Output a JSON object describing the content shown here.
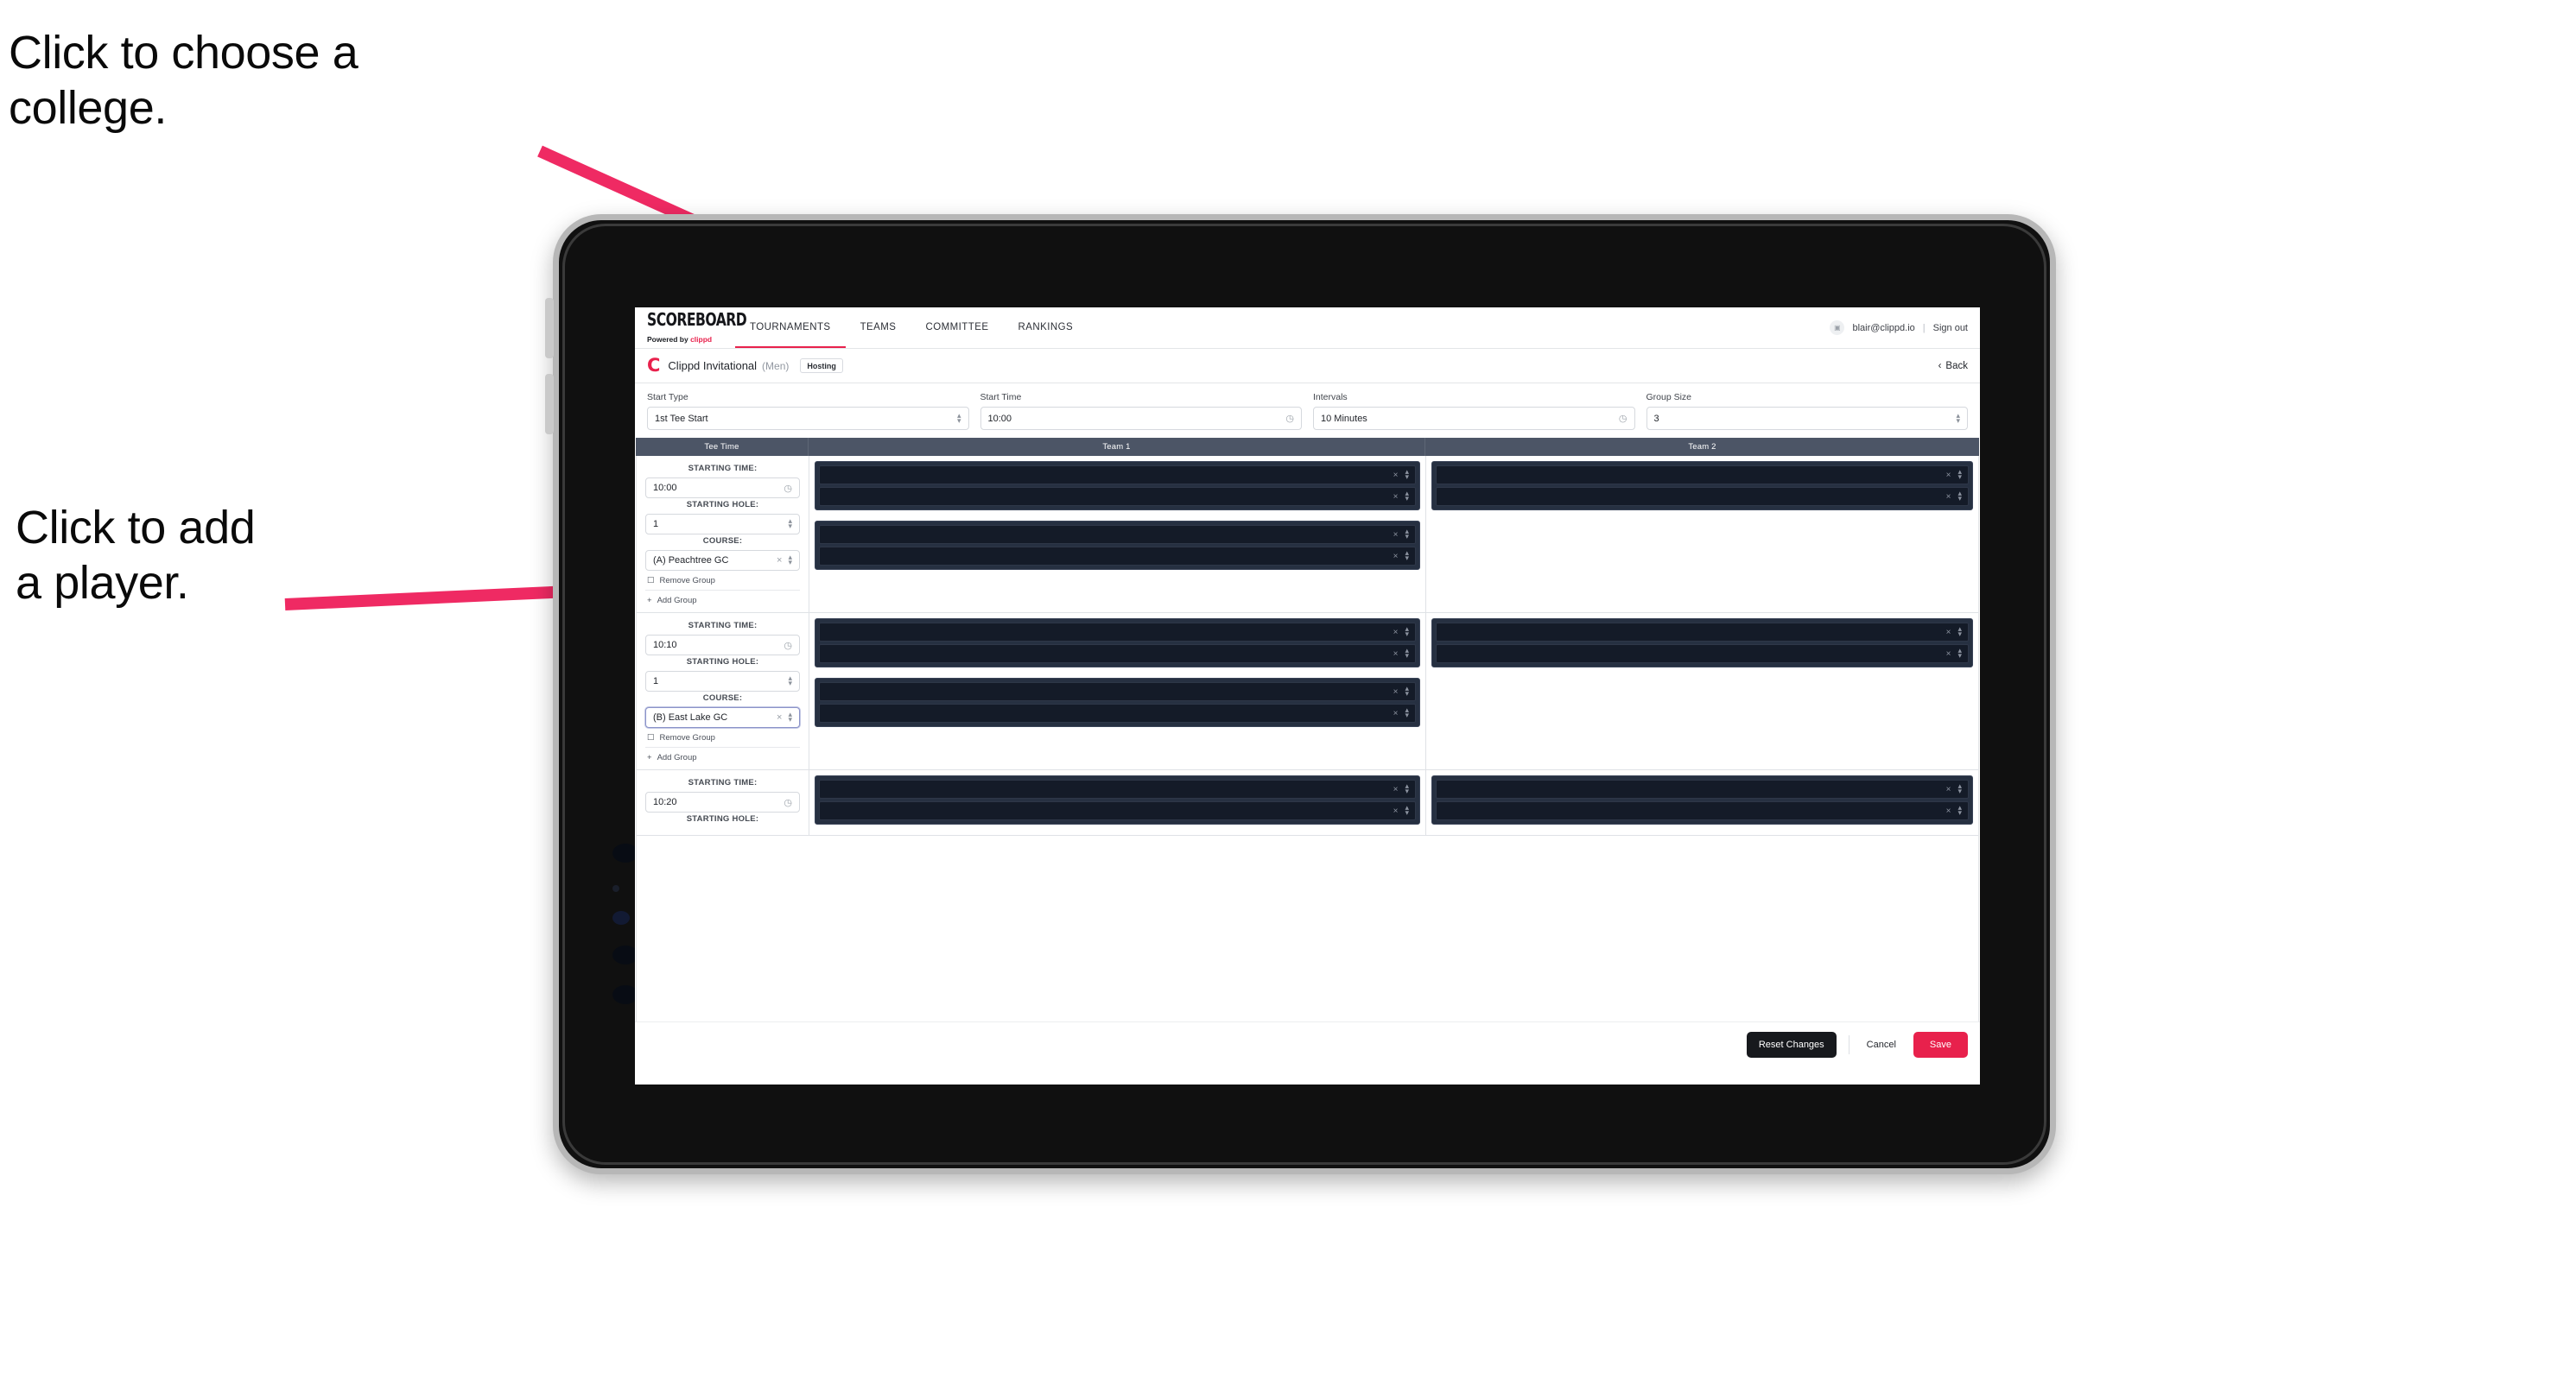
{
  "annotations": {
    "college": "Click to choose a\ncollege.",
    "player": "Click to add\na player."
  },
  "accent": "#e8214c",
  "nav": {
    "brand_word": "SCOREBOARD",
    "brand_sub_prefix": "Powered by ",
    "brand_sub_accent": "clippd",
    "tabs": [
      {
        "label": "TOURNAMENTS",
        "active": true
      },
      {
        "label": "TEAMS",
        "active": false
      },
      {
        "label": "COMMITTEE",
        "active": false
      },
      {
        "label": "RANKINGS",
        "active": false
      }
    ],
    "avatar_glyph": "▣",
    "email": "blair@clippd.io",
    "separator": "|",
    "sign_out": "Sign out"
  },
  "tournament": {
    "logo_letter": "C",
    "name": "Clippd Invitational",
    "gender": "(Men)",
    "badge": "Hosting",
    "back_chevron": "‹",
    "back_label": "Back"
  },
  "settings": [
    {
      "label": "Start Type",
      "value": "1st Tee Start",
      "adornment": "stepper"
    },
    {
      "label": "Start Time",
      "value": "10:00",
      "adornment": "clock"
    },
    {
      "label": "Intervals",
      "value": "10 Minutes",
      "adornment": "clock"
    },
    {
      "label": "Group Size",
      "value": "3",
      "adornment": "stepper"
    }
  ],
  "table": {
    "headers": {
      "tee_time": "Tee Time",
      "team1": "Team 1",
      "team2": "Team 2"
    },
    "captions": {
      "time": "STARTING TIME:",
      "hole": "STARTING HOLE:",
      "course": "COURSE:"
    },
    "links": {
      "remove": "Remove Group",
      "add": "Add Group"
    },
    "icons": {
      "trash": "☐",
      "plus": "+",
      "clock": "◷",
      "clear": "×"
    },
    "rows": [
      {
        "starting_time": "10:00",
        "starting_hole": "1",
        "course": "(A) Peachtree GC",
        "course_focused": false,
        "team1_groups": [
          {
            "slots": 2
          },
          {
            "slots": 2
          }
        ],
        "team2_groups": [
          {
            "slots": 2
          }
        ]
      },
      {
        "starting_time": "10:10",
        "starting_hole": "1",
        "course": "(B) East Lake GC",
        "course_focused": true,
        "team1_groups": [
          {
            "slots": 2
          },
          {
            "slots": 2
          }
        ],
        "team2_groups": [
          {
            "slots": 2
          }
        ]
      },
      {
        "starting_time": "10:20",
        "starting_hole": "",
        "course": "",
        "course_focused": false,
        "partial": true,
        "team1_groups": [
          {
            "slots": 2
          }
        ],
        "team2_groups": [
          {
            "slots": 2
          }
        ]
      }
    ]
  },
  "footer": {
    "reset": "Reset Changes",
    "cancel": "Cancel",
    "save": "Save"
  }
}
